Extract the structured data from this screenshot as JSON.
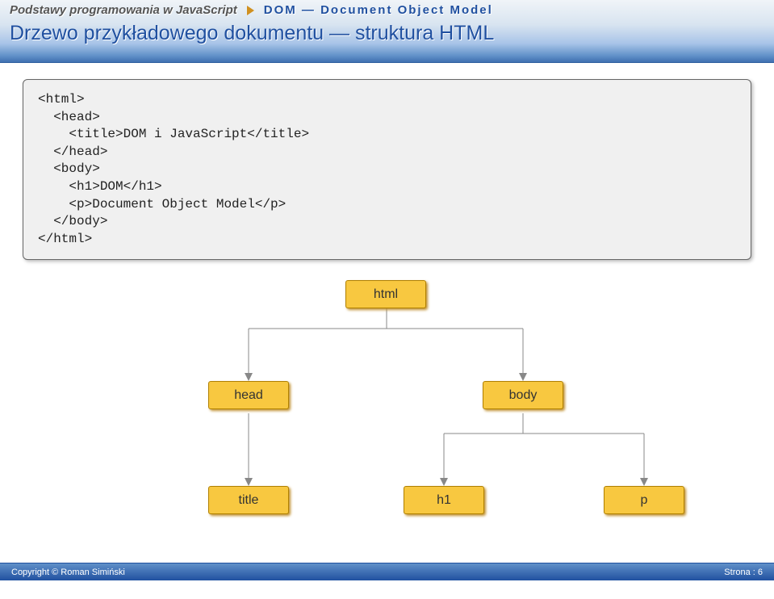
{
  "header": {
    "breadcrumb1": "Podstawy programowania w JavaScript",
    "breadcrumb2": "DOM — Document Object Model",
    "title": "Drzewo przykładowego dokumentu — struktura HTML"
  },
  "code": "<html>\n  <head>\n    <title>DOM i JavaScript</title>\n  </head>\n  <body>\n    <h1>DOM</h1>\n    <p>Document Object Model</p>\n  </body>\n</html>",
  "diagram": {
    "root": "html",
    "level1": {
      "left": "head",
      "right": "body"
    },
    "level2": {
      "a": "title",
      "b": "h1",
      "c": "p"
    }
  },
  "footer": {
    "copyright": "Copyright © Roman Simiński",
    "page": "Strona : 6"
  }
}
